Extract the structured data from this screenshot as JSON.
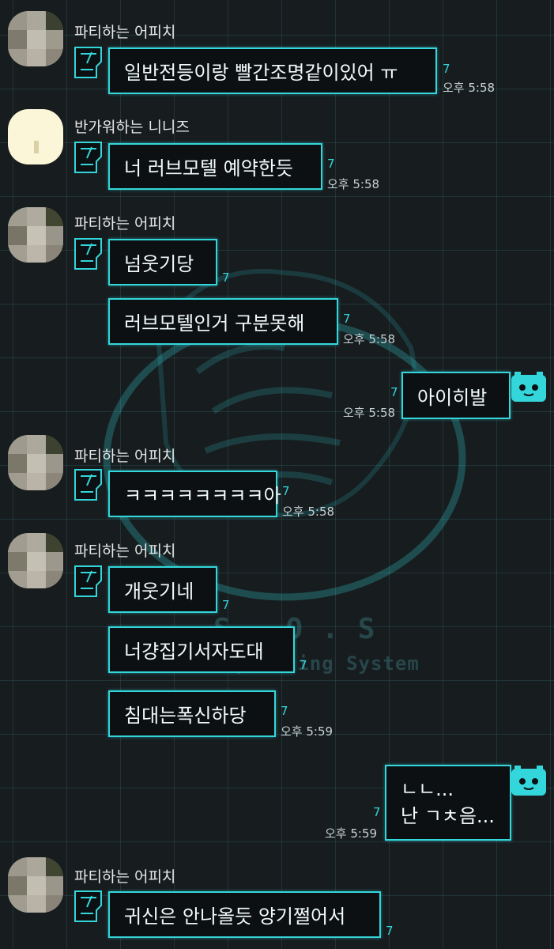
{
  "colors": {
    "accent": "#33d6da",
    "background": "#171c1f",
    "bubble": "#0c1012"
  },
  "icons": {
    "incoming_tag": "robot-tag-icon",
    "outgoing_avatar": "robot-face-icon"
  },
  "watermark": {
    "title": "S.O.S",
    "subtitle": "Soohalo Operating System"
  },
  "messages": [
    {
      "sender": "파티하는 어피치",
      "text": "일반전등이랑 빨간조명같이있어 ㅠ",
      "read": "7",
      "time": "오후 5:58"
    },
    {
      "sender": "반가워하는 니니즈",
      "text": "너 러브모텔 예약한듯",
      "read": "7",
      "time": "오후 5:58"
    },
    {
      "sender": "파티하는 어피치",
      "text": "넘웃기당",
      "read": "7"
    },
    {
      "text": "러브모텔인거 구분못해",
      "read": "7",
      "time": "오후 5:58"
    },
    {
      "text": "아이히발",
      "read": "7",
      "time": "오후 5:58"
    },
    {
      "sender": "파티하는 어피치",
      "text": "ㅋㅋㅋㅋㅋㅋㅋㅋ아",
      "read": "7",
      "time": "오후 5:58"
    },
    {
      "sender": "파티하는 어피치",
      "text": "개웃기네",
      "read": "7"
    },
    {
      "text": "너걍집기서자도대",
      "read": "7"
    },
    {
      "text": "침대는폭신하당",
      "read": "7",
      "time": "오후 5:59"
    },
    {
      "lines": [
        "ㄴㄴ...",
        "난 ㄱㅊ음..."
      ],
      "read": "7",
      "time": "오후 5:59"
    },
    {
      "sender": "파티하는 어피치",
      "text": "귀신은 안나올듯 양기쩔어서",
      "read": "7"
    }
  ]
}
